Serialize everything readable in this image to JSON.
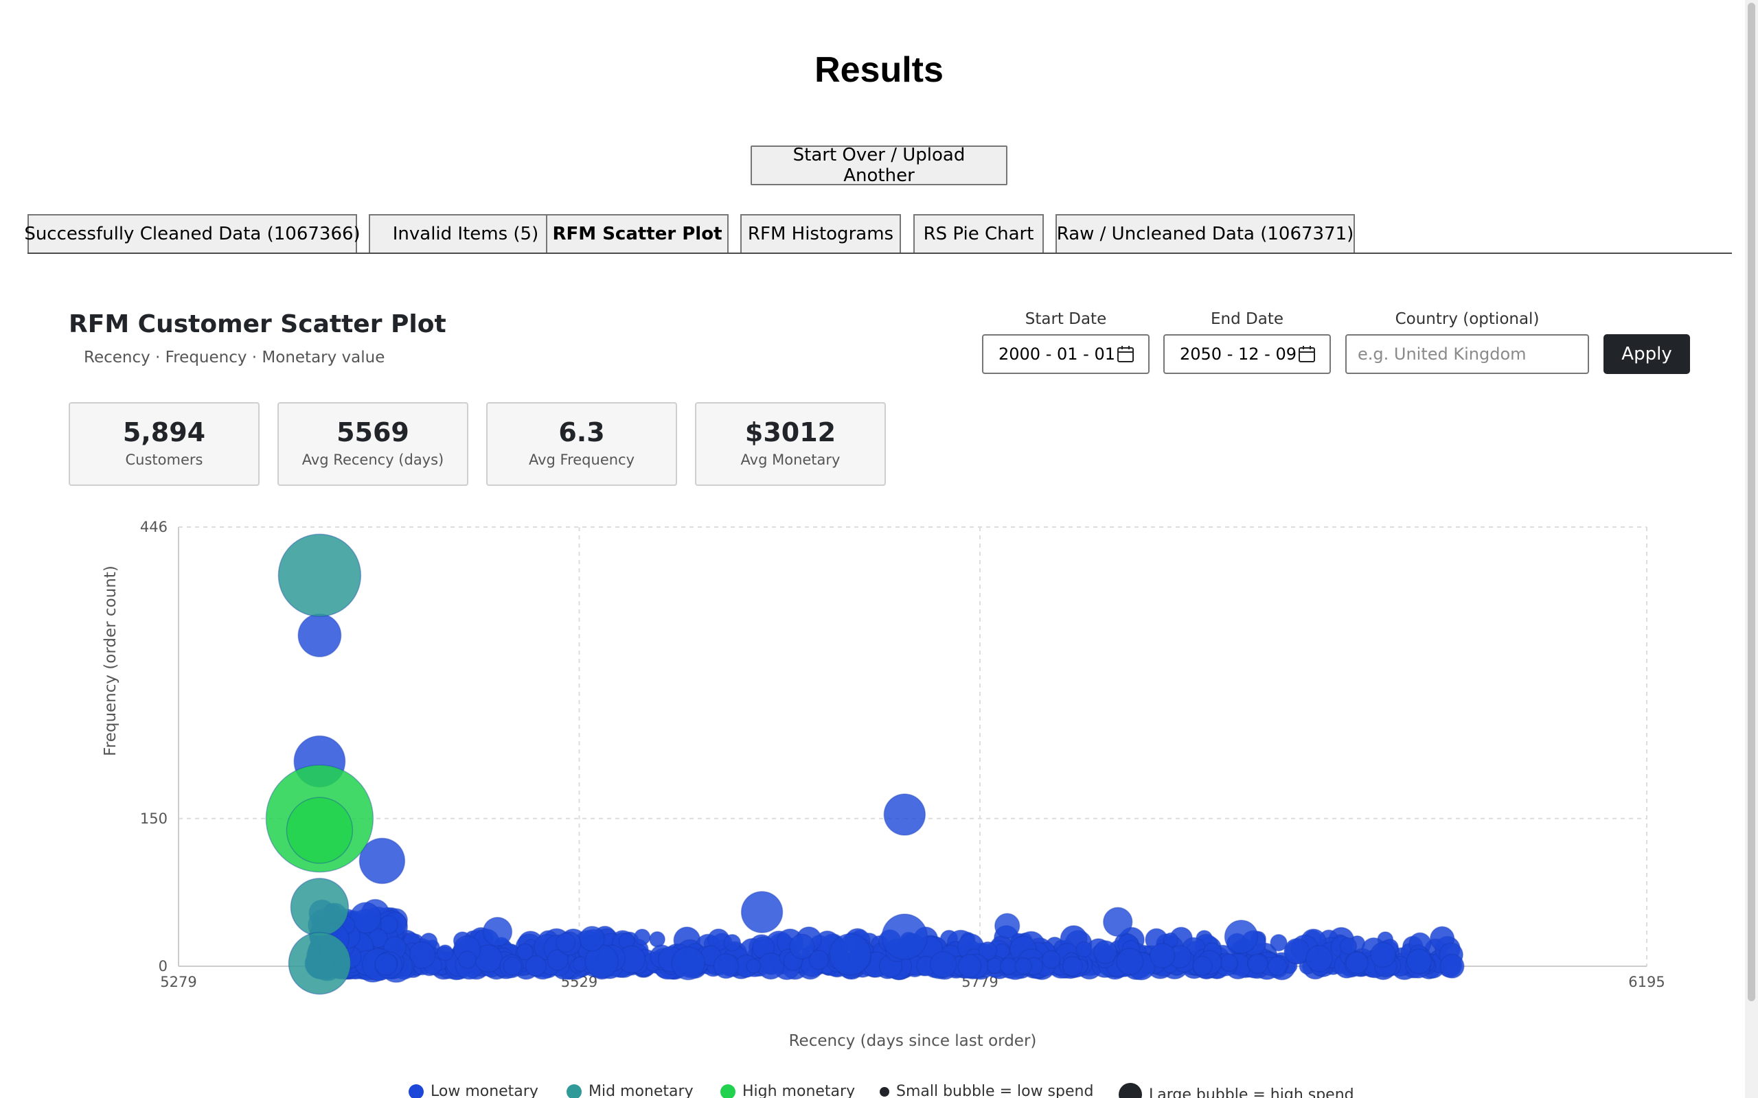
{
  "page": {
    "title": "Results",
    "start_over_label": "Start Over / Upload Another"
  },
  "tabs": [
    {
      "label": "Successfully Cleaned Data (1067366)",
      "active": false
    },
    {
      "label": "Invalid Items (5)",
      "active": false
    },
    {
      "label": "RFM Scatter Plot",
      "active": true
    },
    {
      "label": "RFM Histograms",
      "active": false
    },
    {
      "label": "RS Pie Chart",
      "active": false
    },
    {
      "label": "Raw / Uncleaned Data (1067371)",
      "active": false
    }
  ],
  "filters": {
    "start_date_label": "Start Date",
    "start_date_value": "2000 - 01 - 01",
    "end_date_label": "End Date",
    "end_date_value": "2050 - 12 - 09",
    "country_label": "Country (optional)",
    "country_placeholder": "e.g. United Kingdom",
    "apply_label": "Apply",
    "calendar_icon": "calendar-icon"
  },
  "stats": [
    {
      "value": "5,894",
      "label": "Customers"
    },
    {
      "value": "5569",
      "label": "Avg Recency (days)"
    },
    {
      "value": "6.3",
      "label": "Avg Frequency"
    },
    {
      "value": "$3012",
      "label": "Avg Monetary"
    }
  ],
  "legend": [
    {
      "label": "Low monetary",
      "color": "#1c47d8"
    },
    {
      "label": "Mid monetary",
      "color": "#2f9a98"
    },
    {
      "label": "High monetary",
      "color": "#22d24e"
    },
    {
      "label": "Small bubble = low spend",
      "color": "#212529"
    },
    {
      "label": "Large bubble = high spend",
      "color": "#212529"
    }
  ],
  "colors": {
    "low": "#1c47d8",
    "mid": "#2f9a98",
    "high": "#22d24e"
  },
  "chart_data": {
    "type": "scatter",
    "title": "RFM Customer Scatter Plot",
    "subtitle": "Recency · Frequency · Monetary value",
    "xlabel": "Recency (days since last order)",
    "ylabel": "Frequency (order count)",
    "xlim": [
      5279,
      6195
    ],
    "ylim": [
      0,
      446
    ],
    "xticks": [
      5279,
      5529,
      5779,
      6195
    ],
    "yticks": [
      0,
      150,
      446
    ],
    "grid": true,
    "legend_position": "bottom-center",
    "points": [
      {
        "recency": 5367,
        "frequency": 397,
        "monetary": "high",
        "size": 1.0,
        "tier": "mid"
      },
      {
        "recency": 5367,
        "frequency": 336,
        "monetary": "low",
        "size": 0.52,
        "tier": "low"
      },
      {
        "recency": 5367,
        "frequency": 208,
        "monetary": "low",
        "size": 0.62,
        "tier": "low"
      },
      {
        "recency": 5367,
        "frequency": 150,
        "monetary": "high",
        "size": 1.3,
        "tier": "high"
      },
      {
        "recency": 5367,
        "frequency": 138,
        "monetary": "high",
        "size": 0.8,
        "tier": "high"
      },
      {
        "recency": 5406,
        "frequency": 107,
        "monetary": "low",
        "size": 0.55,
        "tier": "low"
      },
      {
        "recency": 5367,
        "frequency": 60,
        "monetary": "mid",
        "size": 0.7,
        "tier": "mid"
      },
      {
        "recency": 5367,
        "frequency": 3,
        "monetary": "mid",
        "size": 0.75,
        "tier": "mid"
      },
      {
        "recency": 5732,
        "frequency": 154,
        "monetary": "low",
        "size": 0.5,
        "tier": "low"
      },
      {
        "recency": 5643,
        "frequency": 55,
        "monetary": "low",
        "size": 0.5,
        "tier": "low"
      },
      {
        "recency": 5732,
        "frequency": 30,
        "monetary": "low",
        "size": 0.55,
        "tier": "low"
      },
      {
        "recency": 5796,
        "frequency": 41,
        "monetary": "low",
        "size": 0.3,
        "tier": "low"
      },
      {
        "recency": 5865,
        "frequency": 45,
        "monetary": "low",
        "size": 0.35,
        "tier": "low"
      },
      {
        "recency": 5942,
        "frequency": 30,
        "monetary": "low",
        "size": 0.4,
        "tier": "low"
      },
      {
        "recency": 5543,
        "frequency": 5,
        "monetary": "low",
        "size": 0.4,
        "tier": "low"
      },
      {
        "recency": 5597,
        "frequency": 3,
        "monetary": "low",
        "size": 0.4,
        "tier": "low"
      },
      {
        "recency": 5698,
        "frequency": 12,
        "monetary": "low",
        "size": 0.5,
        "tier": "low"
      },
      {
        "recency": 5478,
        "frequency": 35,
        "monetary": "low",
        "size": 0.35,
        "tier": "low"
      },
      {
        "recency": 5537,
        "frequency": 28,
        "monetary": "low",
        "size": 0.3,
        "tier": "low"
      },
      {
        "recency": 5668,
        "frequency": 20,
        "monetary": "low",
        "size": 0.3,
        "tier": "low"
      },
      {
        "recency": 6053,
        "frequency": 5,
        "monetary": "low",
        "size": 0.3,
        "tier": "low"
      }
    ],
    "note": "dense band of several thousand low-monetary customers at frequency 0–30 across recency 5367–6074"
  }
}
